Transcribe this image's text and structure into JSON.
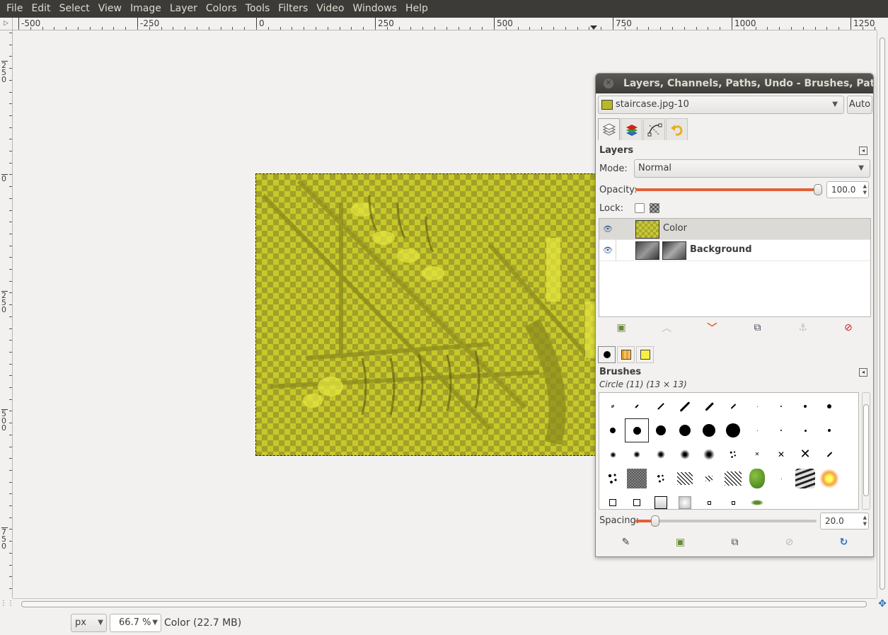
{
  "menubar": {
    "items": [
      "File",
      "Edit",
      "Select",
      "View",
      "Image",
      "Layer",
      "Colors",
      "Tools",
      "Filters",
      "Video",
      "Windows",
      "Help"
    ]
  },
  "rulers": {
    "horizontal_labels": [
      "-500",
      "-250",
      "0",
      "250",
      "500",
      "750",
      "1000",
      "1250"
    ],
    "vertical_labels": [
      "250",
      "0",
      "250",
      "500",
      "750"
    ]
  },
  "statusbar": {
    "unit": "px",
    "zoom": "66.7 %",
    "message": "Color (22.7 MB)"
  },
  "dock": {
    "title": "Layers, Channels, Paths, Undo - Brushes, Patterns",
    "image_combo": "staircase.jpg-10",
    "auto_button": "Auto",
    "tabs": [
      "layers-tab-icon",
      "channels-tab-icon",
      "paths-tab-icon",
      "undo-tab-icon"
    ],
    "layers": {
      "title": "Layers",
      "mode_label": "Mode:",
      "mode_value": "Normal",
      "opacity_label": "Opacity:",
      "opacity_value": "100.0",
      "opacity_level": 1.0,
      "lock_label": "Lock:",
      "items": [
        {
          "name": "Color",
          "selected": true,
          "visible": true
        },
        {
          "name": "Background",
          "selected": false,
          "visible": true
        }
      ]
    },
    "brushes": {
      "title": "Brushes",
      "selected_brush": "Circle (11) (13 × 13)",
      "spacing_label": "Spacing:",
      "spacing_value": "20.0",
      "spacing_level": 0.2
    }
  },
  "colors": {
    "menubar_bg": "#3c3b37",
    "layer_tint": "#c8c82a",
    "accent": "#e1613a"
  }
}
